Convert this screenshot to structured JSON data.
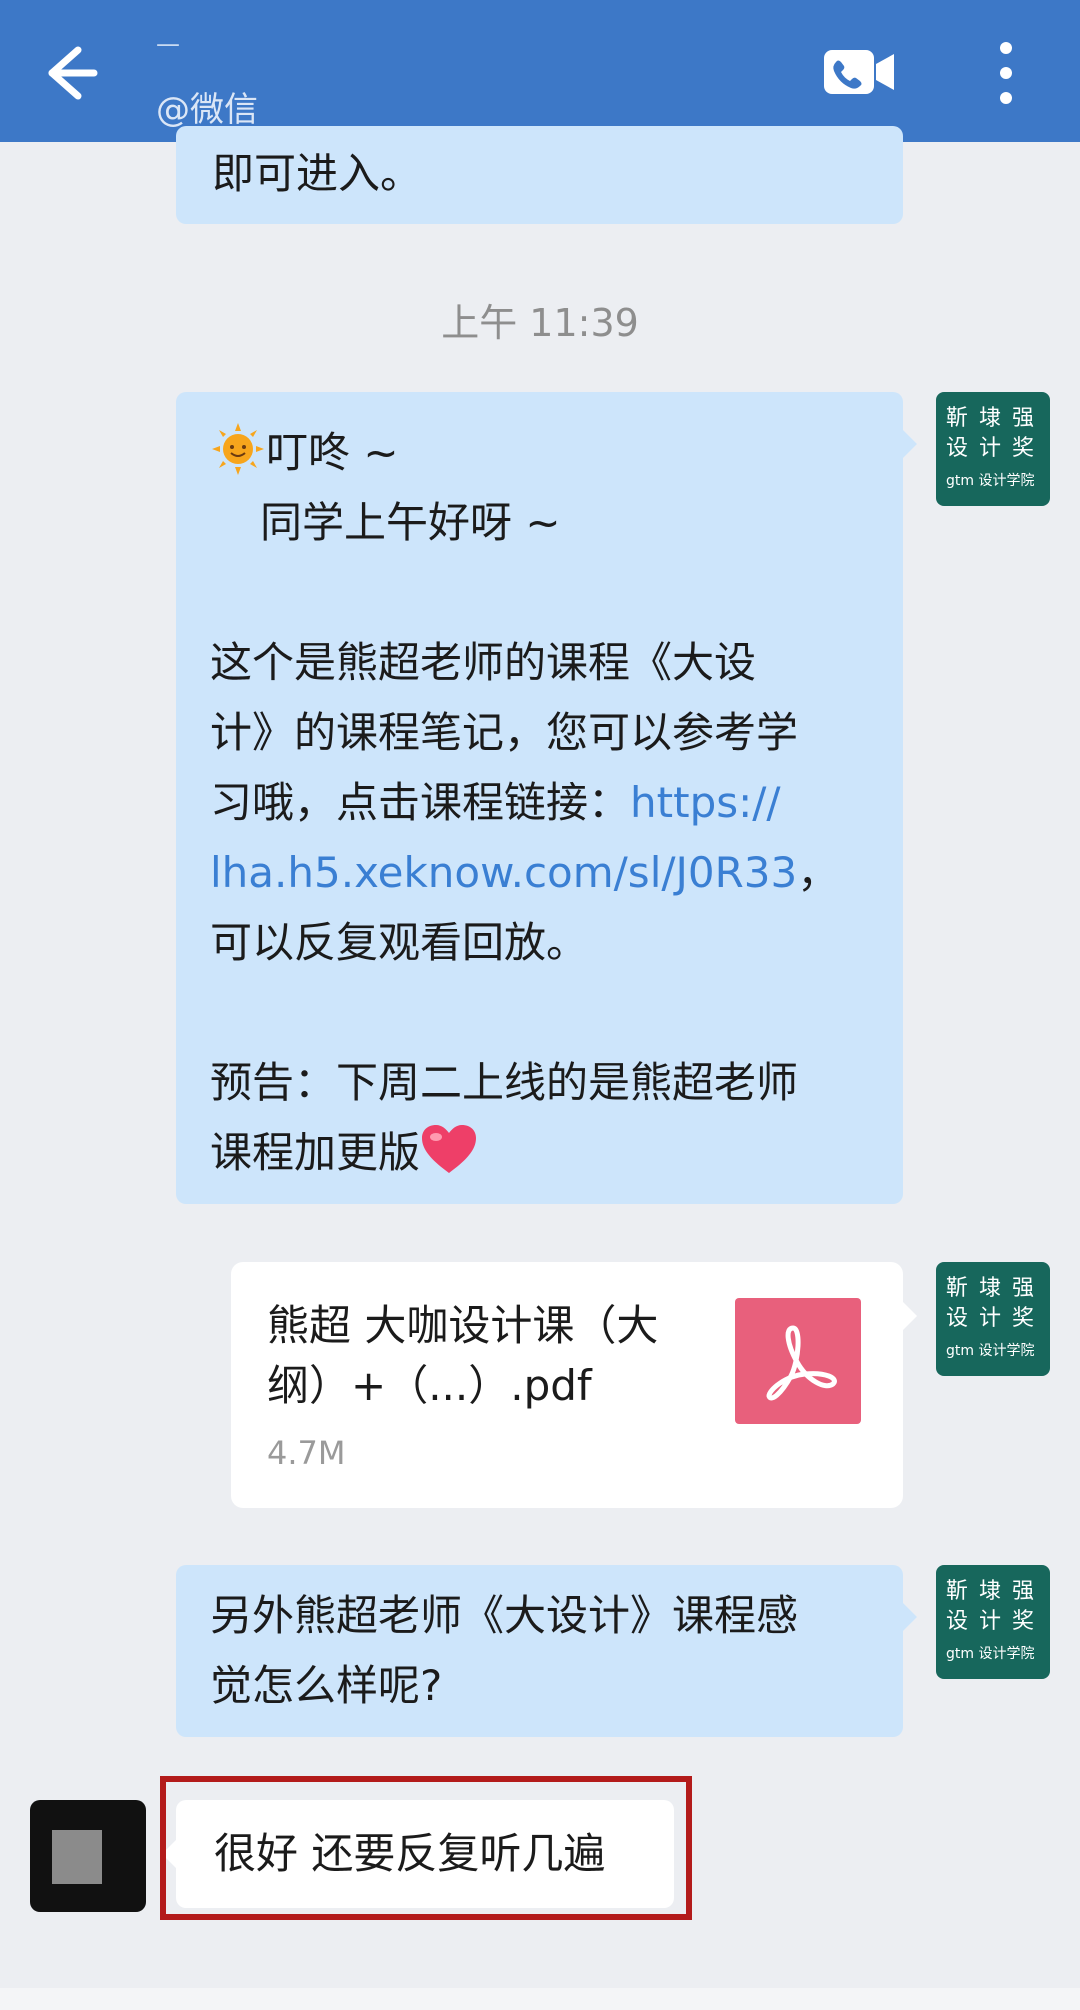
{
  "header": {
    "title": "—",
    "subtitle": "@微信",
    "back_icon": "arrow-left-icon",
    "call_icon": "video-call-icon",
    "more_icon": "more-vertical-icon",
    "bar_color": "#3d78c7"
  },
  "messages": {
    "m0_text": "即可进入。",
    "timestamp": "上午 11:39",
    "m1": {
      "line1": "叮咚 ~",
      "line2": "同学上午好呀 ~",
      "p1_line1": "这个是熊超老师的课程《大设",
      "p1_line2": "计》的课程笔记，您可以参考学",
      "p1_line3_text": "习哦，点击课程链接：",
      "link_part1": "https://",
      "link_part2": "lha.h5.xeknow.com/sl/J0R33",
      "link_after": "，",
      "p1_line5": "可以反复观看回放。",
      "p2_line1": "预告：下周二上线的是熊超老师",
      "p2_line2": "课程加更版"
    },
    "file": {
      "name": "熊超 大咖设计课（大纲）+（...）.pdf",
      "size": "4.7M",
      "icon": "pdf-icon"
    },
    "m3": {
      "line1": "另外熊超老师《大设计》课程感",
      "line2": "觉怎么样呢?"
    },
    "reply": "很好 还要反复听几遍"
  },
  "sender_avatar": {
    "row1": "靳 埭 强",
    "row2": "设 计 奖",
    "brand": "gtm 设计学院",
    "color": "#17675c"
  },
  "colors": {
    "bubble_blue": "#cde5fb",
    "link_blue": "#3a7fd3",
    "highlight_red": "#b31b1b",
    "pdf_pink": "#e8607c"
  }
}
